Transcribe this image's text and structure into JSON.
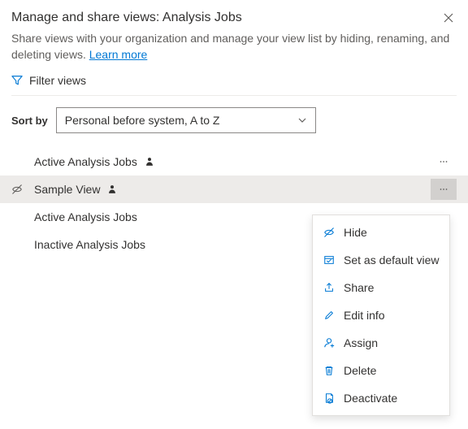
{
  "header": {
    "title": "Manage and share views: Analysis Jobs"
  },
  "description": {
    "text": "Share views with your organization and manage your view list by hiding, renaming, and deleting views. ",
    "link": "Learn more"
  },
  "filter": {
    "label": "Filter views"
  },
  "sort": {
    "label": "Sort by",
    "value": "Personal before system, A to Z"
  },
  "views": [
    {
      "label": "Active Analysis Jobs",
      "personal": true,
      "hidden": false,
      "selected": false,
      "showMore": true
    },
    {
      "label": "Sample View",
      "personal": true,
      "hidden": true,
      "selected": true,
      "showMore": true
    },
    {
      "label": "Active Analysis Jobs",
      "personal": false,
      "hidden": false,
      "selected": false,
      "showMore": false
    },
    {
      "label": "Inactive Analysis Jobs",
      "personal": false,
      "hidden": false,
      "selected": false,
      "showMore": false
    }
  ],
  "contextMenu": [
    {
      "label": "Hide",
      "icon": "hide"
    },
    {
      "label": "Set as default view",
      "icon": "default"
    },
    {
      "label": "Share",
      "icon": "share"
    },
    {
      "label": "Edit info",
      "icon": "edit"
    },
    {
      "label": "Assign",
      "icon": "assign"
    },
    {
      "label": "Delete",
      "icon": "delete"
    },
    {
      "label": "Deactivate",
      "icon": "deactivate"
    }
  ]
}
